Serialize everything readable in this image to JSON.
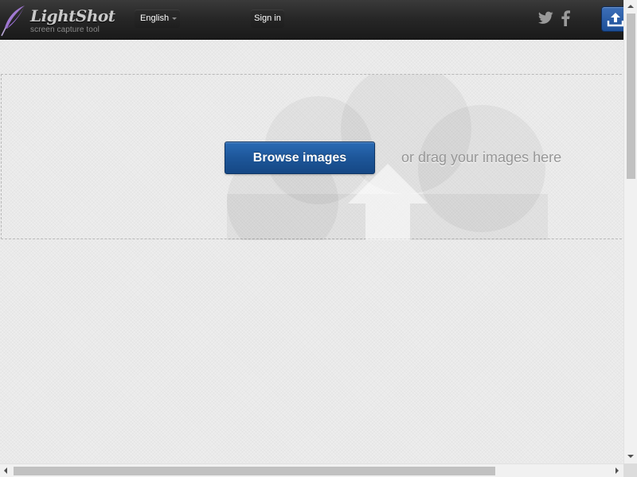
{
  "header": {
    "logo": {
      "title": "LightShot",
      "subtitle": "screen capture tool",
      "icon": "feather-icon"
    },
    "language": {
      "selected": "English",
      "icon": "chevron-down-icon"
    },
    "signin_label": "Sign in",
    "social": {
      "twitter_icon": "twitter-icon",
      "facebook_icon": "facebook-icon"
    },
    "upload_icon": "upload-icon"
  },
  "dropzone": {
    "browse_label": "Browse images",
    "drag_text": "or drag your images here",
    "background_icon": "cloud-upload-icon"
  },
  "colors": {
    "header_bg": "#262626",
    "accent_blue": "#1d5699",
    "page_bg": "#ededed",
    "drag_text": "#969696"
  }
}
